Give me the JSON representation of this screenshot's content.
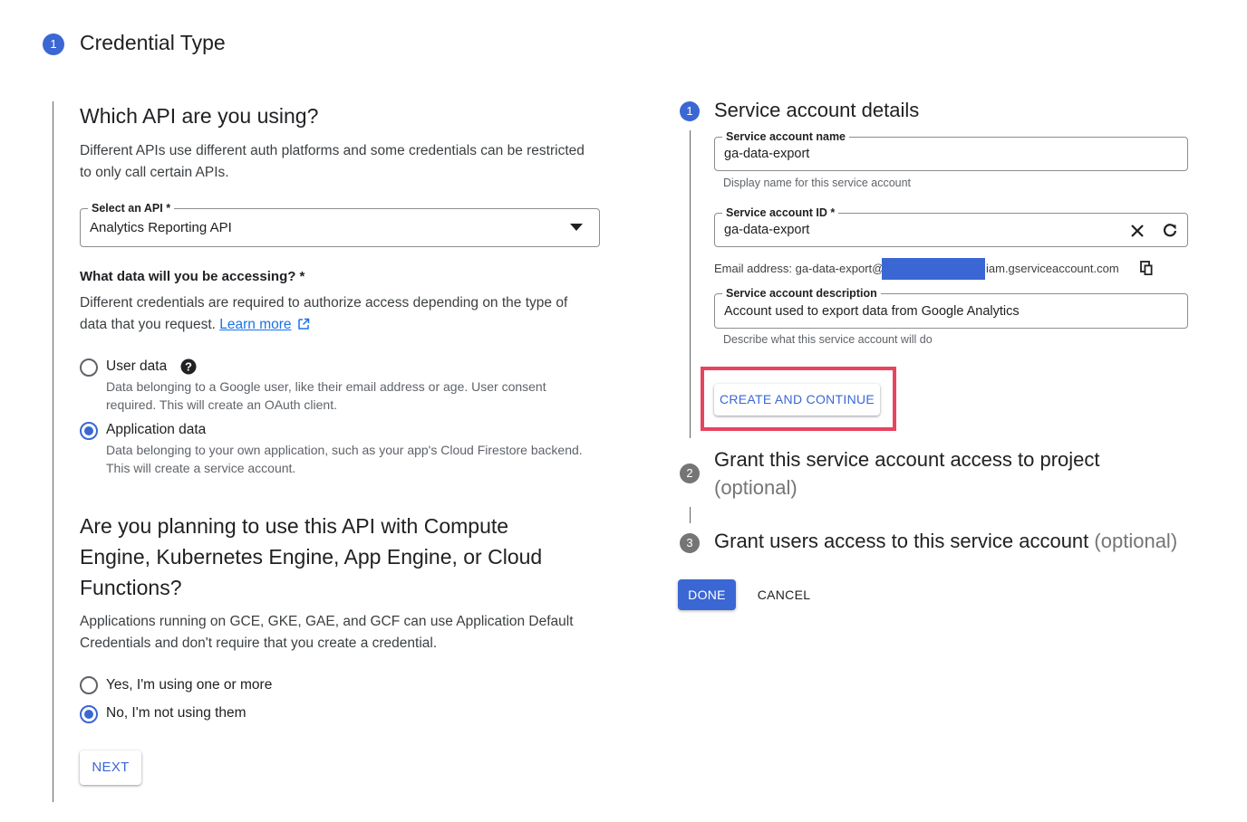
{
  "header": {
    "step": "1",
    "title": "Credential Type"
  },
  "left": {
    "api_heading": "Which API are you using?",
    "api_desc_line1": "Different APIs use different auth platforms and some credentials can be restricted",
    "api_desc_line2": "to only call certain APIs.",
    "select": {
      "label": "Select an API *",
      "value": "Analytics Reporting API"
    },
    "data_heading": "What data will you be accessing? *",
    "data_desc_line1": "Different credentials are required to authorize access depending on the type of",
    "data_desc_line2": "data that you request.",
    "learn_more": "Learn more",
    "options": [
      {
        "label": "User data",
        "desc_line1": "Data belonging to a Google user, like their email address or age. User consent",
        "desc_line2": "required. This will create an OAuth client.",
        "checked": false
      },
      {
        "label": "Application data",
        "desc_line1": "Data belonging to your own application, such as your app's Cloud Firestore backend.",
        "desc_line2": "This will create a service account.",
        "checked": true
      }
    ],
    "compute_heading_line1": "Are you planning to use this API with Compute",
    "compute_heading_line2": "Engine, Kubernetes Engine, App Engine, or Cloud",
    "compute_heading_line3": "Functions?",
    "compute_desc_line1": "Applications running on GCE, GKE, GAE, and GCF can use Application Default",
    "compute_desc_line2": "Credentials and don't require that you create a credential.",
    "compute_options": [
      {
        "label": "Yes, I'm using one or more",
        "checked": false
      },
      {
        "label": "No, I'm not using them",
        "checked": true
      }
    ],
    "next_label": "NEXT"
  },
  "right": {
    "step1": {
      "num": "1",
      "title": "Service account details"
    },
    "name_field": {
      "label": "Service account name",
      "value": "ga-data-export",
      "hint": "Display name for this service account"
    },
    "id_field": {
      "label": "Service account ID *",
      "value": "ga-data-export"
    },
    "email": {
      "prefix": "Email address: ga-data-export@",
      "suffix": "iam.gserviceaccount.com"
    },
    "desc_field": {
      "label": "Service account description",
      "value": "Account used to export data from Google Analytics",
      "hint": "Describe what this service account will do"
    },
    "create_label": "CREATE AND CONTINUE",
    "step2": {
      "num": "2",
      "title_line1": "Grant this service account access to project",
      "title_line2": "(optional)"
    },
    "step3": {
      "num": "3",
      "title": "Grant users access to this service account",
      "optional": "(optional)"
    },
    "done_label": "DONE",
    "cancel_label": "CANCEL"
  },
  "colors": {
    "primary": "#3b67d4",
    "highlight": "#e8435f",
    "redaction": "#3b67d4"
  },
  "icons": [
    "dropdown-arrow-icon",
    "help-icon",
    "external-link-icon",
    "clear-icon",
    "refresh-icon",
    "copy-icon"
  ]
}
